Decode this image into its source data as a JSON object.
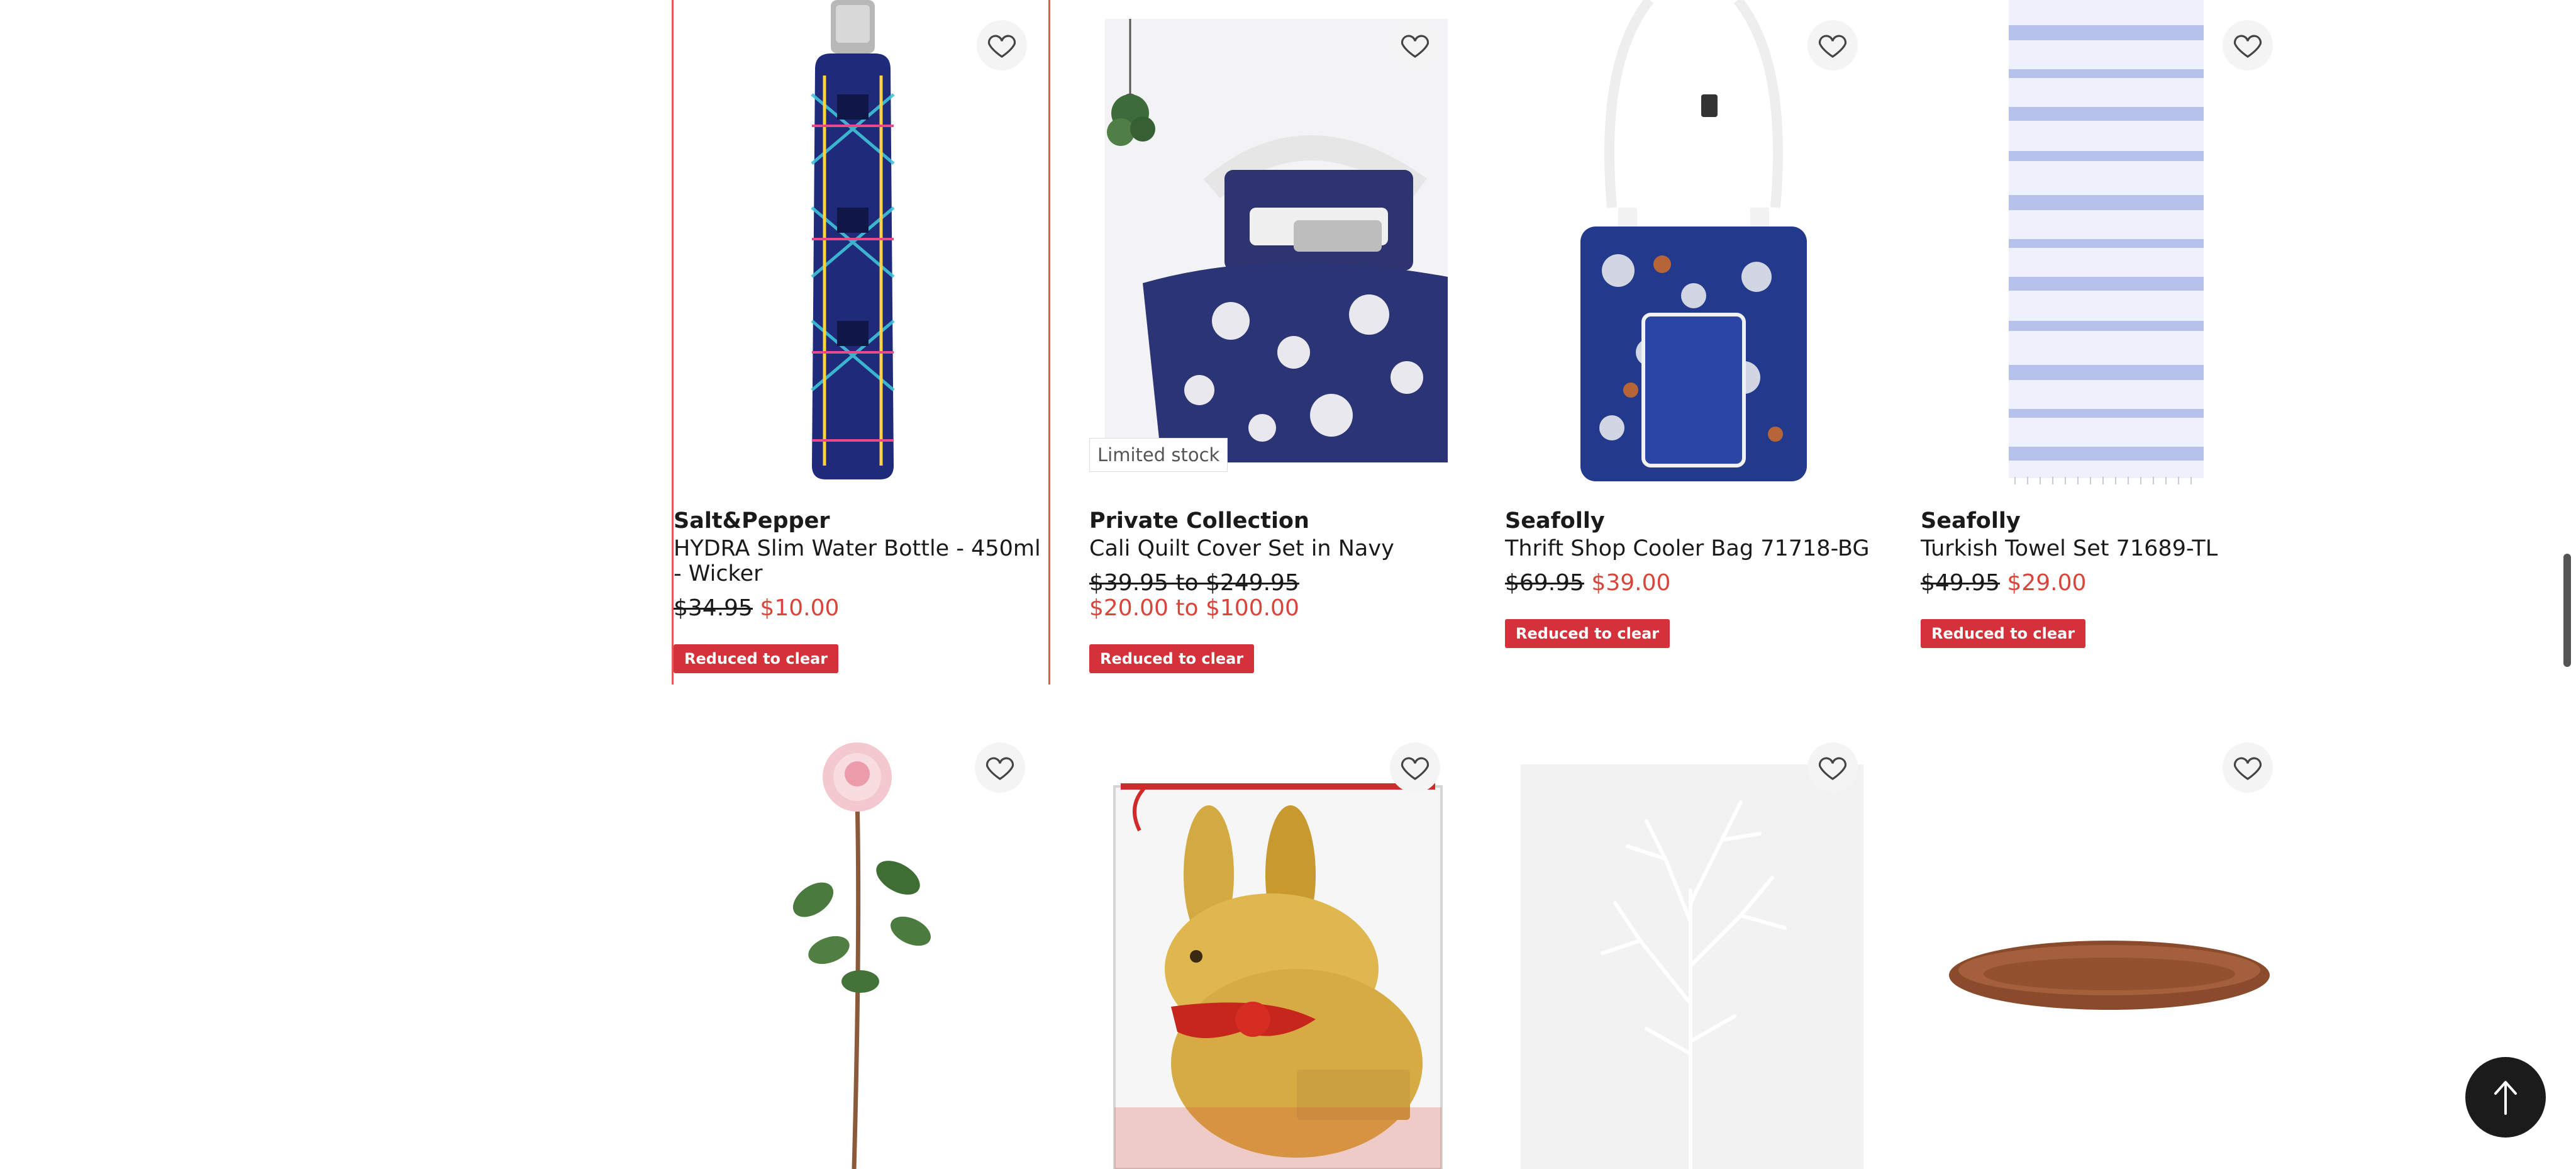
{
  "products_row1": [
    {
      "brand": "Salt&Pepper",
      "name": "HYDRA Slim Water Bottle - 450ml - Wicker",
      "was_price": "$34.95",
      "now_price": "$10.00",
      "badge": "Reduced to clear"
    },
    {
      "brand": "Private Collection",
      "name": "Cali Quilt Cover Set in Navy",
      "was_price": "$39.95 to $249.95",
      "now_price": "$20.00 to $100.00",
      "badge": "Reduced to clear",
      "stock_label": "Limited stock"
    },
    {
      "brand": "Seafolly",
      "name": "Thrift Shop Cooler Bag 71718-BG",
      "was_price": "$69.95",
      "now_price": "$39.00",
      "badge": "Reduced to clear"
    },
    {
      "brand": "Seafolly",
      "name": "Turkish Towel Set 71689-TL",
      "was_price": "$49.95",
      "now_price": "$29.00",
      "badge": "Reduced to clear"
    }
  ],
  "colors": {
    "accent": "#d9453b",
    "badge_bg": "#d5313a",
    "selected_border": "#e05a4f"
  },
  "icons": {
    "wishlist": "heart-outline-icon",
    "back_to_top": "arrow-up-icon"
  }
}
